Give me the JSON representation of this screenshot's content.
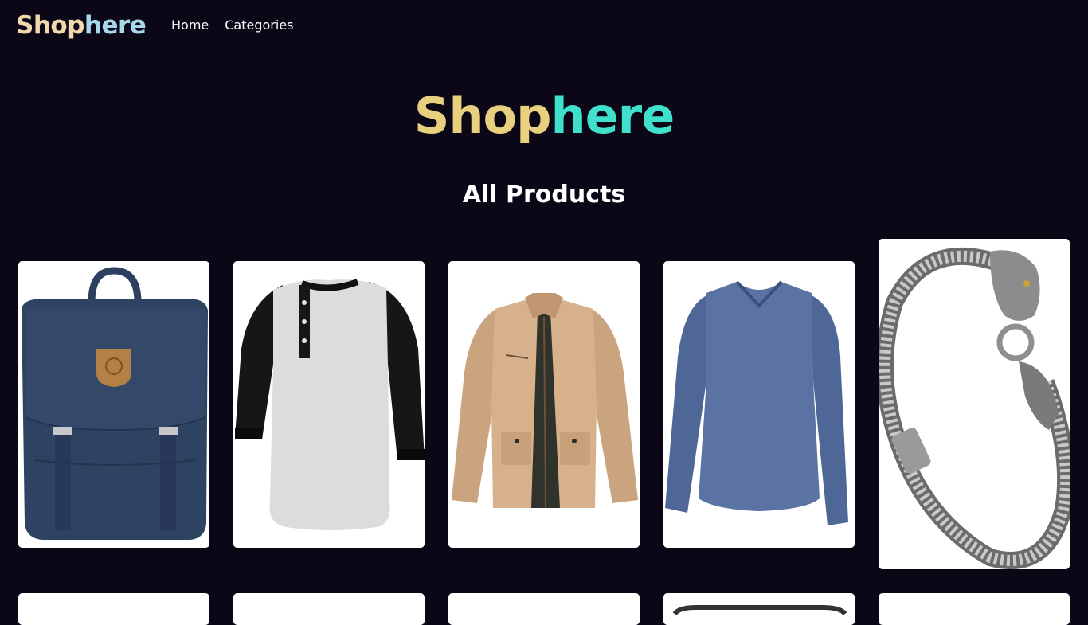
{
  "nav": {
    "logo_part1": "Shop",
    "logo_part2": "here",
    "links": [
      "Home",
      "Categories"
    ]
  },
  "hero": {
    "title_part1": "Shop",
    "title_part2": "here"
  },
  "section": {
    "title": "All Products"
  },
  "products_row1": [
    {
      "image": "navy-backpack"
    },
    {
      "image": "raglan-henley-shirt"
    },
    {
      "image": "khaki-jacket"
    },
    {
      "image": "blue-long-sleeve-tee"
    },
    {
      "image": "silver-dragon-bracelet"
    }
  ],
  "colors": {
    "background": "#0b0717",
    "hero_shop": "#e8d07e",
    "hero_here": "#3fe0cc",
    "nav_shop": "#f2d8ad",
    "nav_here": "#a6d8ec"
  }
}
